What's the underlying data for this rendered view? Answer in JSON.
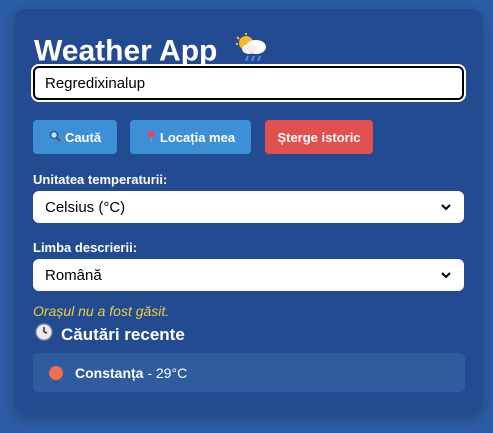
{
  "app": {
    "title": "Weather App",
    "title_icon": "sun-behind-rain-cloud-icon"
  },
  "search": {
    "value": "Regredixinalup",
    "placeholder": ""
  },
  "buttons": {
    "search_label": "Caută",
    "location_label": "Locația mea",
    "clear_label": "Șterge istoric"
  },
  "temperature": {
    "label": "Unitatea temperaturii:",
    "selected": "Celsius (°C)"
  },
  "language": {
    "label": "Limba descrierii:",
    "selected": "Română"
  },
  "status": {
    "error": "Orașul nu a fost găsit."
  },
  "recent": {
    "title": "Căutări recente",
    "items": [
      {
        "city": "Constanța",
        "temp": " - 29°C"
      }
    ]
  },
  "colors": {
    "background": "#2c5ca6",
    "card": "#224b91",
    "primary_button": "#3d8fd6",
    "danger_button": "#e0504f",
    "error_text": "#f2cc3d",
    "recent_dot": "#f06e52"
  }
}
